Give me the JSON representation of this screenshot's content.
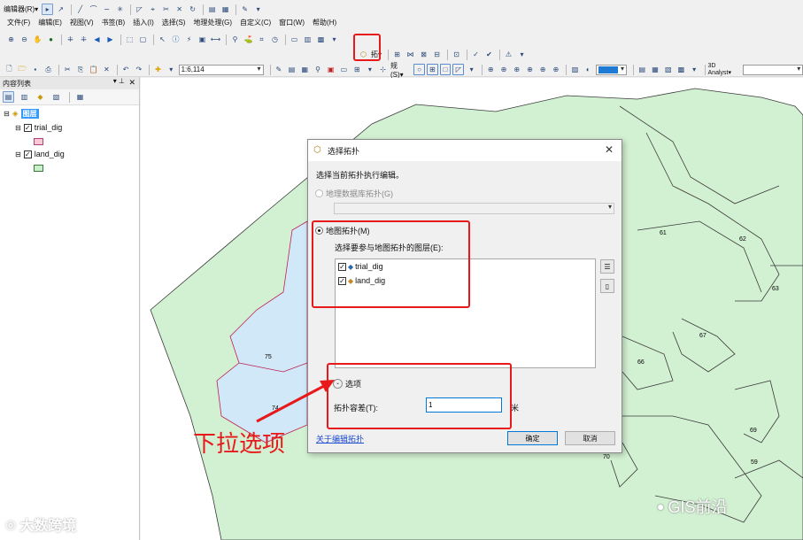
{
  "toolbar_top": {
    "editor_label": "编辑器(R)▾"
  },
  "menu": [
    "文件(F)",
    "编辑(E)",
    "视图(V)",
    "书签(B)",
    "插入(I)",
    "选择(S)",
    "地理处理(G)",
    "自定义(C)",
    "窗口(W)",
    "帮助(H)"
  ],
  "standard": {
    "scale_value": "1:6,114",
    "selection_label": "规(S)▾",
    "analyst_label": "3D Analyst▾"
  },
  "toc": {
    "title": "内容列表",
    "root": "图层",
    "layers": [
      {
        "name": "trial_dig",
        "swatch": "#f8c8d8",
        "swatch_border": "#b0407a"
      },
      {
        "name": "land_dig",
        "swatch": "#c8efc8",
        "swatch_border": "#3a7a3a"
      }
    ]
  },
  "map": {
    "labels": [
      "61",
      "62",
      "63",
      "67",
      "66",
      "75",
      "74",
      "70",
      "69",
      "59"
    ]
  },
  "dialog": {
    "title": "选择拓扑",
    "instruction": "选择当前拓扑执行编辑。",
    "geodatabase_option": "地理数据库拓扑(G)",
    "map_option": "地图拓扑(M)",
    "layers_prompt": "选择要参与地图拓扑的图层(E):",
    "layers": [
      "trial_dig",
      "land_dig"
    ],
    "options_toggle": "选项",
    "tolerance_label": "拓扑容差(T):",
    "tolerance_value": "1",
    "unit": "米",
    "help_link": "关于编辑拓扑",
    "ok": "确定",
    "cancel": "取消"
  },
  "annotation": {
    "text": "下拉选项",
    "color": "#e8191b"
  },
  "watermarks": {
    "left": "大数跨境",
    "right": "GIS前沿"
  }
}
